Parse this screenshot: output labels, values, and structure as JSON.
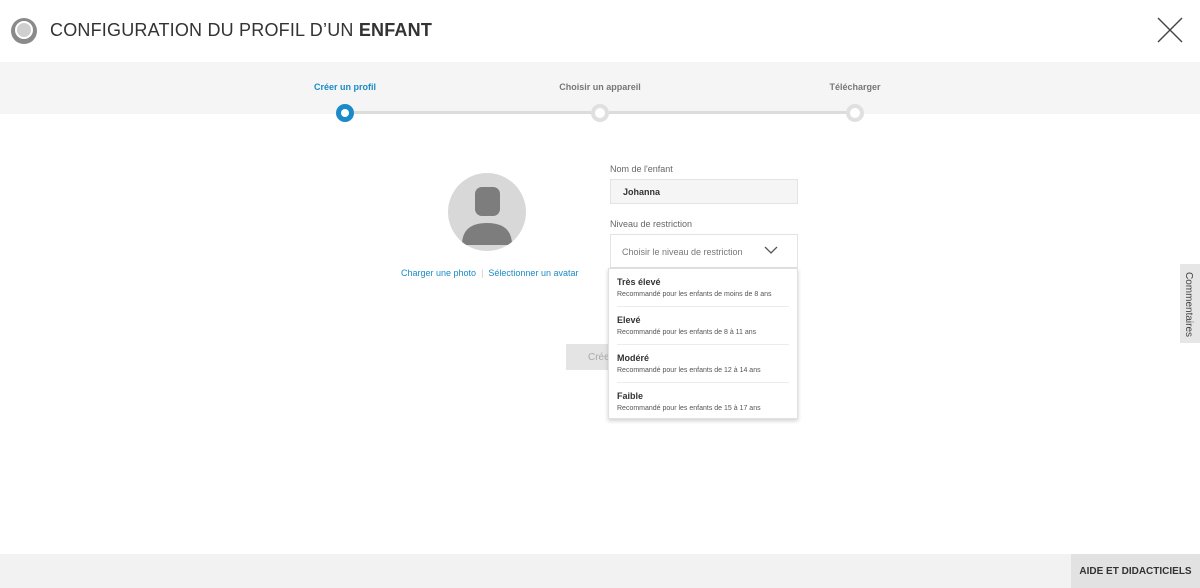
{
  "header": {
    "title_prefix": "CONFIGURATION DU PROFIL D’UN ",
    "title_bold": "ENFANT",
    "logo_icon": "profile-logo-icon",
    "close_icon": "close-icon"
  },
  "stepper": {
    "steps": [
      {
        "label": "Créer un profil",
        "state": "active"
      },
      {
        "label": "Choisir un appareil",
        "state": "inactive"
      },
      {
        "label": "Télécharger",
        "state": "inactive"
      }
    ],
    "accent_color": "#1a8bc8"
  },
  "avatar": {
    "upload_link": "Charger une photo",
    "select_link": "Sélectionner un avatar"
  },
  "form": {
    "name_label": "Nom de l'enfant",
    "name_value": "Johanna",
    "restriction_label": "Niveau de restriction",
    "restriction_placeholder": "Choisir le niveau de restriction",
    "create_button_visible": "Crée"
  },
  "dropdown": {
    "options": [
      {
        "title": "Très élevé",
        "desc": "Recommandé pour les enfants de moins de 8 ans"
      },
      {
        "title": "Elevé",
        "desc": "Recommandé pour les enfants de 8 à 11 ans"
      },
      {
        "title": "Modéré",
        "desc": "Recommandé pour les enfants de 12 à 14 ans"
      },
      {
        "title": "Faible",
        "desc": "Recommandé pour les enfants de 15 à 17 ans"
      }
    ]
  },
  "feedback": {
    "label": "Commentaires"
  },
  "footer": {
    "help_button": "AIDE ET DIDACTICIELS"
  }
}
